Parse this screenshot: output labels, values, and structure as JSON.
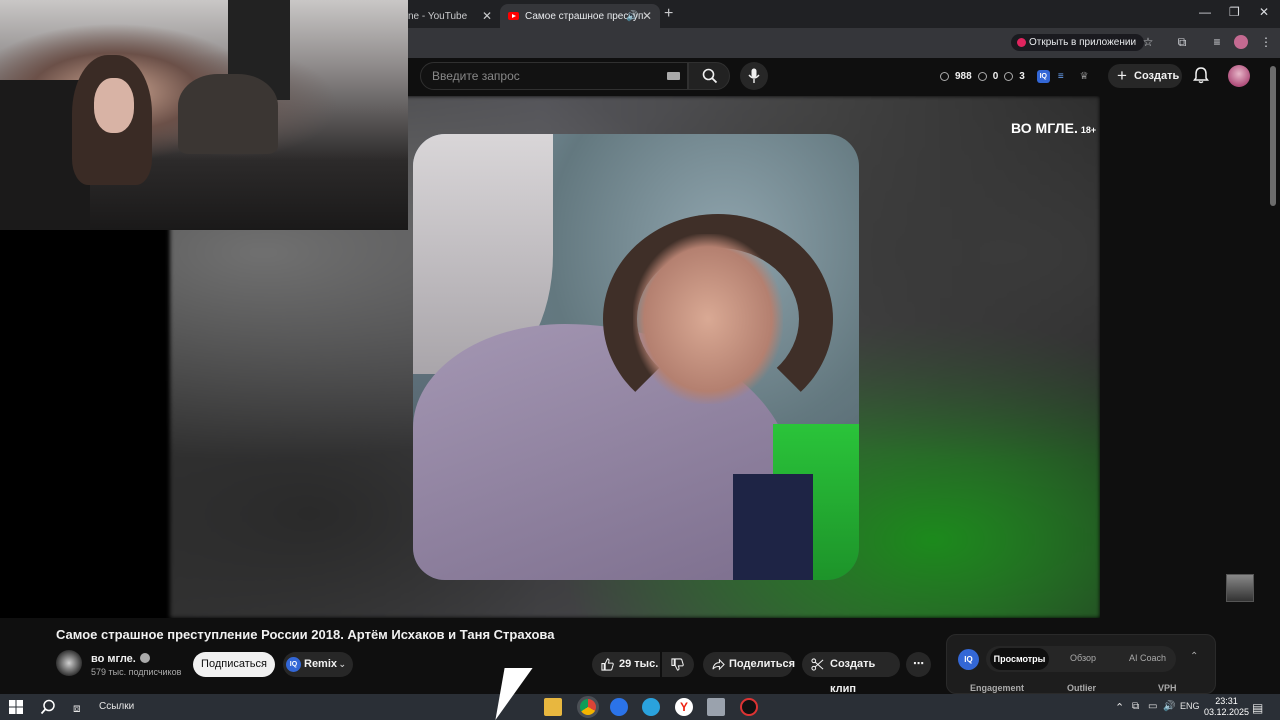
{
  "browser": {
    "tabs": [
      {
        "label": "ne - YouTube",
        "active": false
      },
      {
        "label": "Самое страшное преступ",
        "active": true
      }
    ],
    "new_tab": "+",
    "window_controls": [
      "—",
      "❐",
      "✕"
    ],
    "open_in_app": "Открыть в приложении"
  },
  "header": {
    "search_placeholder": "Введите запрос",
    "stats": [
      "988",
      "0",
      "3"
    ],
    "create_label": "Создать"
  },
  "video": {
    "watermark": "ВО МГЛЕ.",
    "age_rating": "18+"
  },
  "details": {
    "title": "Самое страшное преступление России 2018. Артём Исхаков и Таня Страхова",
    "channel_name": "во мгле.",
    "subscribers": "579 тыс. подписчиков",
    "subscribe_label": "Подписаться",
    "remix_label": "Remix",
    "likes": "29 тыс.",
    "share_label": "Поделиться",
    "clip_label": "Создать клип",
    "more_label": "⋯"
  },
  "side_panel": {
    "badge": "IQ",
    "tabs": [
      "Просмотры",
      "Обзор",
      "AI Coach"
    ],
    "columns": [
      "Engagement",
      "Outlier",
      "VPH"
    ]
  },
  "taskbar": {
    "search_label": "Ссылки",
    "lang": "ENG",
    "time": "23:31",
    "date": "03.12.2025"
  },
  "colors": {
    "accent_red": "#ff0000",
    "iq_blue": "#3367d6",
    "background": "#0f0f0f"
  }
}
